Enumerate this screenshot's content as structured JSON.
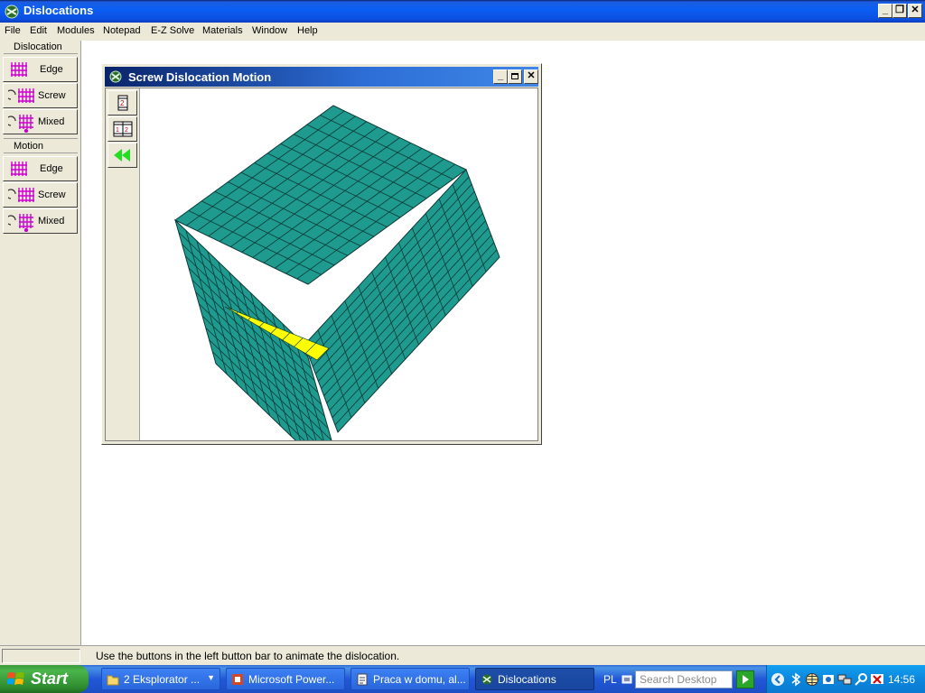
{
  "app": {
    "title": "Dislocations",
    "icon": "dislocations-app-icon",
    "window_buttons": {
      "minimize": "_",
      "restore": "❐",
      "close": "✕"
    }
  },
  "menu": [
    "File",
    "Edit",
    "Modules",
    "Notepad",
    "E-Z Solve",
    "Materials",
    "Window",
    "Help"
  ],
  "sidebar": {
    "groups": [
      {
        "label": "Dislocation",
        "buttons": [
          {
            "label": "Edge",
            "icon": "edge-dislocation-icon"
          },
          {
            "label": "Screw",
            "icon": "screw-dislocation-icon"
          },
          {
            "label": "Mixed",
            "icon": "mixed-dislocation-icon"
          }
        ]
      },
      {
        "label": "Motion",
        "buttons": [
          {
            "label": "Edge",
            "icon": "edge-motion-icon"
          },
          {
            "label": "Screw",
            "icon": "screw-motion-icon"
          },
          {
            "label": "Mixed",
            "icon": "mixed-motion-icon"
          }
        ]
      }
    ]
  },
  "child_window": {
    "title": "Screw Dislocation Motion",
    "toolbar": [
      {
        "icon": "single-frame-icon"
      },
      {
        "icon": "animate-frames-icon"
      },
      {
        "icon": "rewind-icon"
      }
    ],
    "colors": {
      "cube": "#1f9a8f",
      "grid": "#0c3a36",
      "slip": "#ffff00"
    }
  },
  "statusbar": {
    "message": "Use the buttons in the left button bar to animate the dislocation."
  },
  "taskbar": {
    "start_label": "Start",
    "tasks": [
      {
        "label": "2 Eksplorator ...",
        "icon": "folder-icon"
      },
      {
        "label": "Microsoft Power...",
        "icon": "powerpoint-icon"
      },
      {
        "label": "Praca w domu, al...",
        "icon": "document-icon"
      },
      {
        "label": "Dislocations",
        "icon": "dislocations-app-icon"
      }
    ],
    "language": "PL",
    "search_placeholder": "Search Desktop",
    "clock": "14:56"
  }
}
